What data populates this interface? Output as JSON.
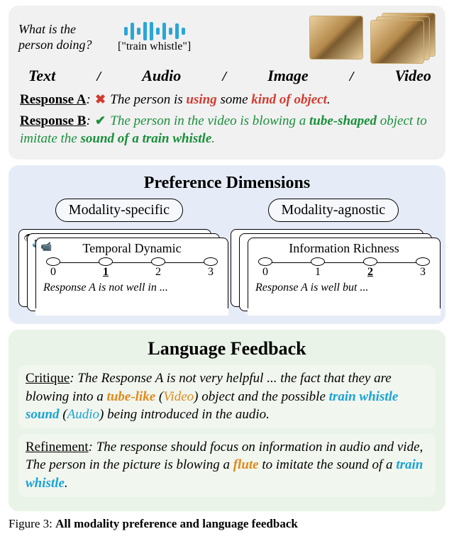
{
  "top": {
    "prompt": "What is the person doing?",
    "audio_label": "[\"train whistle\"]",
    "modalities": [
      "Text",
      "Audio",
      "Image",
      "Video"
    ],
    "sep": "/",
    "responseA": {
      "label": "Response A",
      "colon": ": ",
      "p1": "The person is ",
      "w1": "using",
      "p2": " some ",
      "w2": "kind of object",
      "p3": "."
    },
    "responseB": {
      "label": "Response B",
      "colon": ": ",
      "p1": "The person in the video is blowing a ",
      "w1": "tube-shaped",
      "p2": " object to imitate the ",
      "w2": "sound of a train whistle",
      "p3": "."
    }
  },
  "pref": {
    "title": "Preference Dimensions",
    "dim_specific": "Modality-specific",
    "dim_agnostic": "Modality-agnostic",
    "ticks": [
      "0",
      "1",
      "2",
      "3"
    ],
    "card_left": {
      "title": "Temporal Dynamic",
      "selected_index": 1,
      "note": "Response A is not well in ..."
    },
    "card_right": {
      "title": "Information Richness",
      "selected_index": 2,
      "note": "Response A is well but ..."
    }
  },
  "lf": {
    "title": "Language Feedback",
    "critique": {
      "label": "Critique",
      "colon": ": ",
      "p1": "The Response A is not very helpful ... the fact that they are blowing into a ",
      "o1": "tube-like",
      "sp1": " (",
      "o2": "Video",
      "sp2": ") ",
      "p2": "object and the possible ",
      "c1": "train whistle sound",
      "sp3": " (",
      "c2": "Audio",
      "sp4": ") ",
      "p3": "being introduced in the audio."
    },
    "refine": {
      "label": "Refinement",
      "colon": ": ",
      "p1": "The response should focus on information in audio and vide, The person in the picture is blowing a ",
      "o1": "flute",
      "p2": " to imitate the sound of a ",
      "c1": "train whistle",
      "p3": "."
    }
  },
  "caption": {
    "lead": "Figure 3: ",
    "bold": "All modality preference and language feedback"
  }
}
